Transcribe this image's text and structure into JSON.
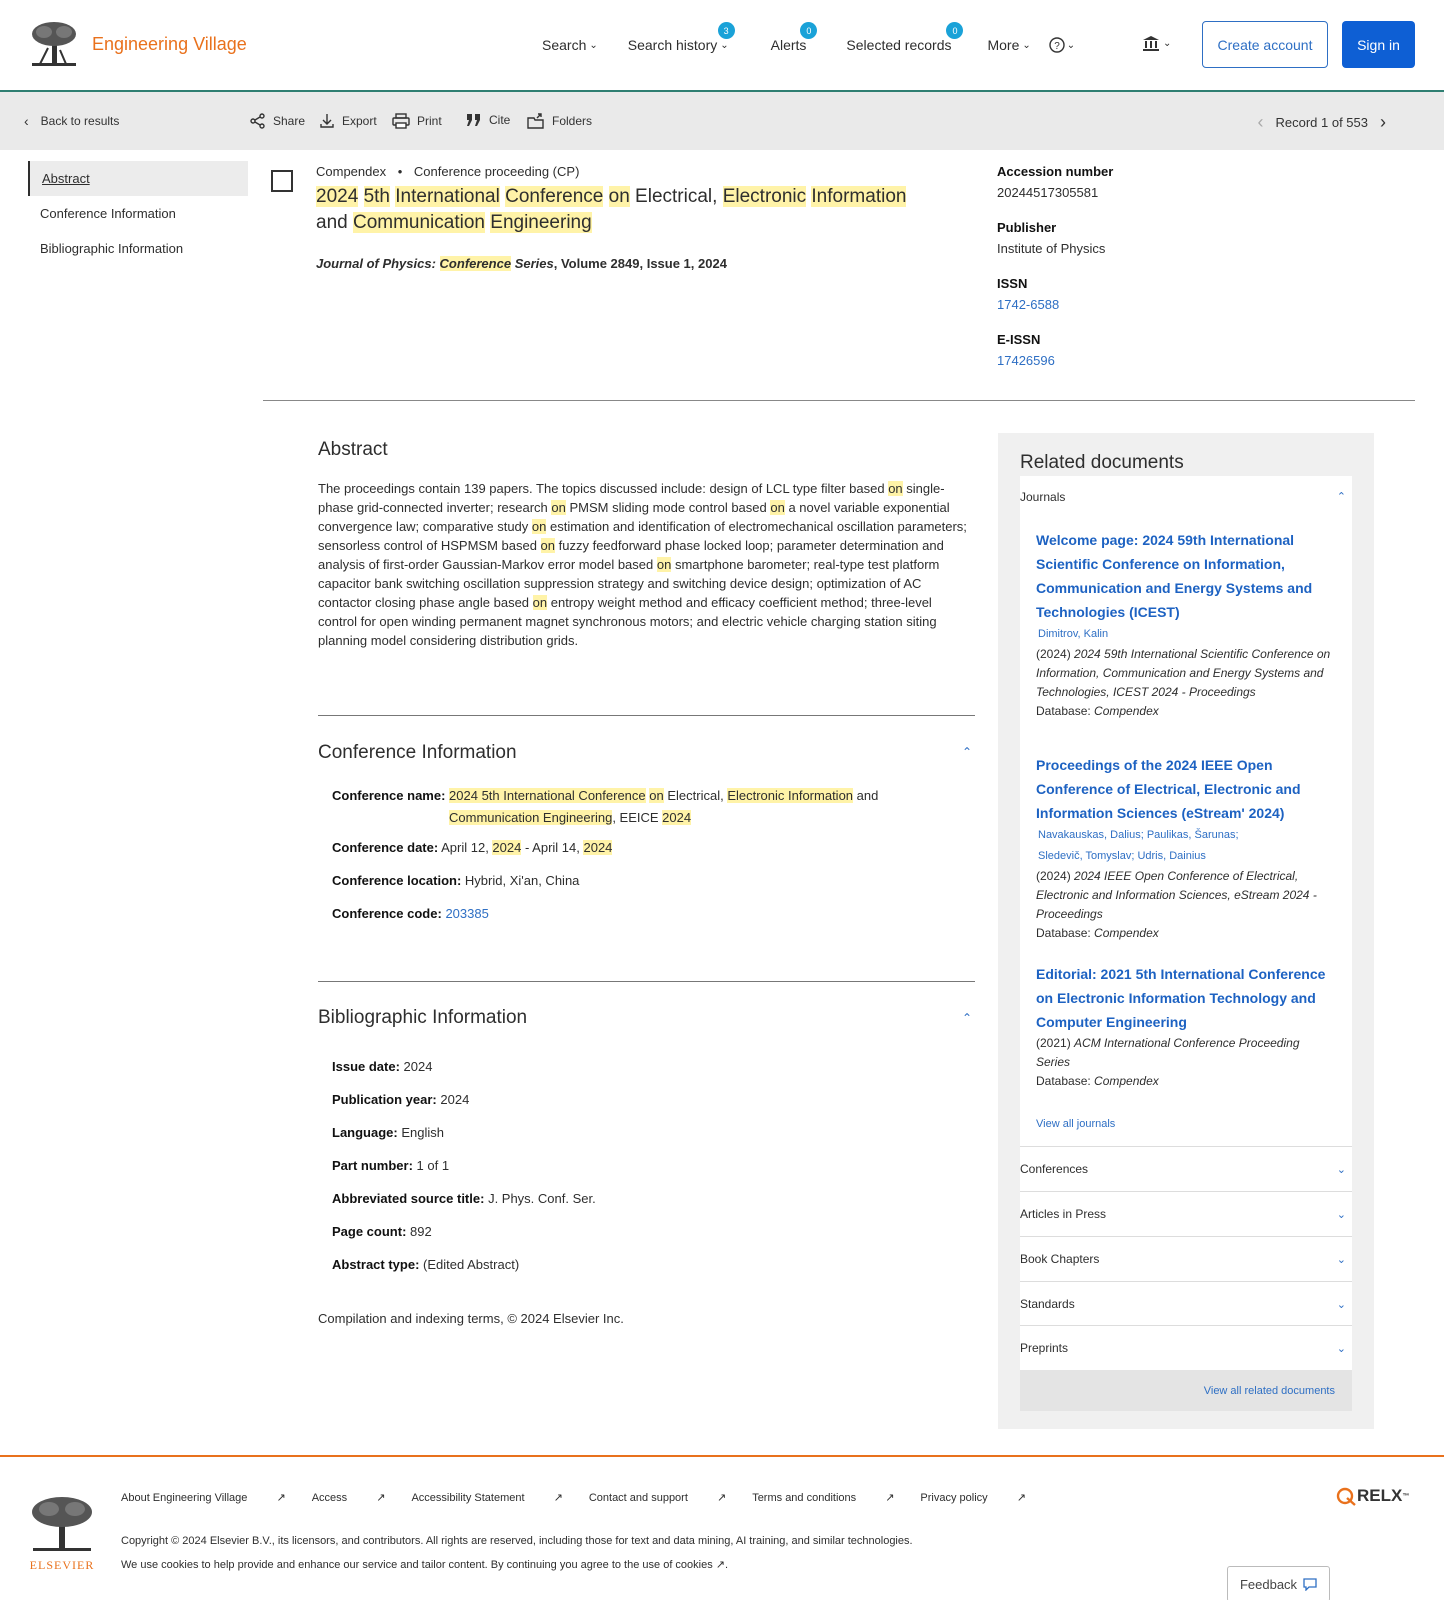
{
  "header": {
    "brand": "Engineering Village",
    "nav": {
      "search": "Search",
      "search_history": "Search history",
      "search_history_count": "3",
      "alerts": "Alerts",
      "alerts_count": "0",
      "selected_records": "Selected records",
      "selected_records_count": "0",
      "more": "More"
    },
    "create_account": "Create account",
    "sign_in": "Sign in"
  },
  "toolbar": {
    "back": "Back to results",
    "share": "Share",
    "export": "Export",
    "print": "Print",
    "cite": "Cite",
    "folders": "Folders",
    "record": "Record 1 of 553"
  },
  "leftnav": [
    "Abstract",
    "Conference Information",
    "Bibliographic Information"
  ],
  "record": {
    "database": "Compendex",
    "doc_type": "Conference proceeding (CP)",
    "title_parts": [
      {
        "t": "2024",
        "h": true
      },
      {
        "t": " ",
        "h": false
      },
      {
        "t": "5th",
        "h": true
      },
      {
        "t": " ",
        "h": false
      },
      {
        "t": "International",
        "h": true
      },
      {
        "t": " ",
        "h": false
      },
      {
        "t": "Conference",
        "h": true
      },
      {
        "t": " ",
        "h": false
      },
      {
        "t": "on",
        "h": true
      },
      {
        "t": " Electrical, ",
        "h": false
      },
      {
        "t": "Electronic",
        "h": true
      },
      {
        "t": " ",
        "h": false
      },
      {
        "t": "Information",
        "h": true
      },
      {
        "t": " and ",
        "h": false
      },
      {
        "t": "Communication",
        "h": true
      },
      {
        "t": " ",
        "h": false
      },
      {
        "t": "Engineering",
        "h": true
      }
    ],
    "journal_prefix": "Journal of Physics: ",
    "journal_hl": "Conference",
    "journal_series": " Series",
    "journal_rest": ", Volume 2849, Issue 1, 2024"
  },
  "side": {
    "accession_label": "Accession number",
    "accession": "20244517305581",
    "publisher_label": "Publisher",
    "publisher": "Institute of Physics",
    "issn_label": "ISSN",
    "issn": "1742-6588",
    "eissn_label": "E-ISSN",
    "eissn": "17426596"
  },
  "abstract": {
    "heading": "Abstract",
    "parts": [
      {
        "t": "The proceedings contain 139 papers. The topics discussed include: design of LCL type filter based ",
        "h": false
      },
      {
        "t": "on",
        "h": true
      },
      {
        "t": " single-phase grid-connected inverter; research ",
        "h": false
      },
      {
        "t": "on",
        "h": true
      },
      {
        "t": " PMSM sliding mode control based ",
        "h": false
      },
      {
        "t": "on",
        "h": true
      },
      {
        "t": " a novel variable exponential convergence law; comparative study ",
        "h": false
      },
      {
        "t": "on",
        "h": true
      },
      {
        "t": " estimation and identification of electromechanical oscillation parameters; sensorless control of HSPMSM based ",
        "h": false
      },
      {
        "t": "on",
        "h": true
      },
      {
        "t": " fuzzy feedforward phase locked loop; parameter determination and analysis of first-order Gaussian-Markov error model based ",
        "h": false
      },
      {
        "t": "on",
        "h": true
      },
      {
        "t": " smartphone barometer; real-type test platform capacitor bank switching oscillation suppression strategy and switching device design; optimization of AC contactor closing phase angle based ",
        "h": false
      },
      {
        "t": "on",
        "h": true
      },
      {
        "t": " entropy weight method and efficacy coefficient method; three-level control for open winding permanent magnet synchronous motors; and electric vehicle charging station siting planning model considering distribution grids.",
        "h": false
      }
    ]
  },
  "conference": {
    "heading": "Conference Information",
    "name_label": "Conference name:",
    "name_parts": [
      {
        "t": "2024 5th International Conference",
        "h": true
      },
      {
        "t": " ",
        "h": false
      },
      {
        "t": "on",
        "h": true
      },
      {
        "t": " Electrical, ",
        "h": false
      },
      {
        "t": "Electronic Information",
        "h": true
      },
      {
        "t": " and",
        "h": false
      }
    ],
    "name_parts2": [
      {
        "t": "Communication Engineering",
        "h": true
      },
      {
        "t": ", EEICE ",
        "h": false
      },
      {
        "t": "2024",
        "h": true
      }
    ],
    "date_label": "Conference date:",
    "date_parts": [
      {
        "t": "April 12, ",
        "h": false
      },
      {
        "t": "2024",
        "h": true
      },
      {
        "t": " - April 14, ",
        "h": false
      },
      {
        "t": "2024",
        "h": true
      }
    ],
    "location_label": "Conference location:",
    "location": "Hybrid, Xi'an, China",
    "code_label": "Conference code:",
    "code": "203385"
  },
  "biblio": {
    "heading": "Bibliographic Information",
    "fields": [
      {
        "label": "Issue date:",
        "value": "2024"
      },
      {
        "label": "Publication year:",
        "value": "2024"
      },
      {
        "label": "Language:",
        "value": "English"
      },
      {
        "label": "Part number:",
        "value": "1 of 1"
      },
      {
        "label": "Abbreviated source title:",
        "value": "J. Phys. Conf. Ser."
      },
      {
        "label": "Page count:",
        "value": "892"
      },
      {
        "label": "Abstract type:",
        "value": "(Edited Abstract)"
      }
    ],
    "copyright": "Compilation and indexing terms, © 2024 Elsevier Inc."
  },
  "related": {
    "heading": "Related documents",
    "journals_label": "Journals",
    "docs": [
      {
        "title": "Welcome page: 2024 59th International Scientific Conference on Information, Communication and Energy Systems and Technologies (ICEST)",
        "authors": [
          "Dimitrov, Kalin"
        ],
        "source_year": "(2024) ",
        "source": "2024 59th International Scientific Conference on Information, Communication and Energy Systems and Technologies, ICEST 2024 - Proceedings",
        "db_label": "Database: ",
        "db": "Compendex"
      },
      {
        "title": "Proceedings of the 2024 IEEE Open Conference of Electrical, Electronic and Information Sciences (eStream' 2024)",
        "authors": [
          "Navakauskas, Dalius; Paulikas, Šarunas;",
          "Sledevič, Tomyslav; Udris, Dainius"
        ],
        "source_year": "(2024) ",
        "source": "2024 IEEE Open Conference of Electrical, Electronic and Information Sciences, eStream 2024 - Proceedings",
        "db_label": "Database: ",
        "db": "Compendex"
      },
      {
        "title": "Editorial: 2021 5th International Conference on Electronic Information Technology and Computer Engineering",
        "authors": [],
        "source_year": "(2021) ",
        "source": "ACM International Conference Proceeding Series",
        "db_label": "Database: ",
        "db": "Compendex"
      }
    ],
    "view_all_journals": "View all journals",
    "categories": [
      "Conferences",
      "Articles in Press",
      "Book Chapters",
      "Standards",
      "Preprints"
    ],
    "view_all": "View all related documents"
  },
  "footer": {
    "elsevier": "ELSEVIER",
    "links": [
      "About Engineering Village",
      "Access",
      "Accessibility Statement",
      "Contact and support",
      "Terms and conditions",
      "Privacy policy"
    ],
    "copyright": "Copyright © 2024 Elsevier B.V., its licensors, and contributors. All rights are reserved, including those for text and data mining, AI training, and similar technologies.",
    "cookies": "We use cookies to help provide and enhance our service and tailor content. By continuing you agree to the use of cookies",
    "relx": "RELX",
    "feedback": "Feedback"
  },
  "colors": {
    "accent": "#e9711c",
    "link": "#2e6fc4",
    "primary": "#0e5fd4",
    "highlight": "#fff3a8",
    "header_rule": "#2f7f72"
  }
}
